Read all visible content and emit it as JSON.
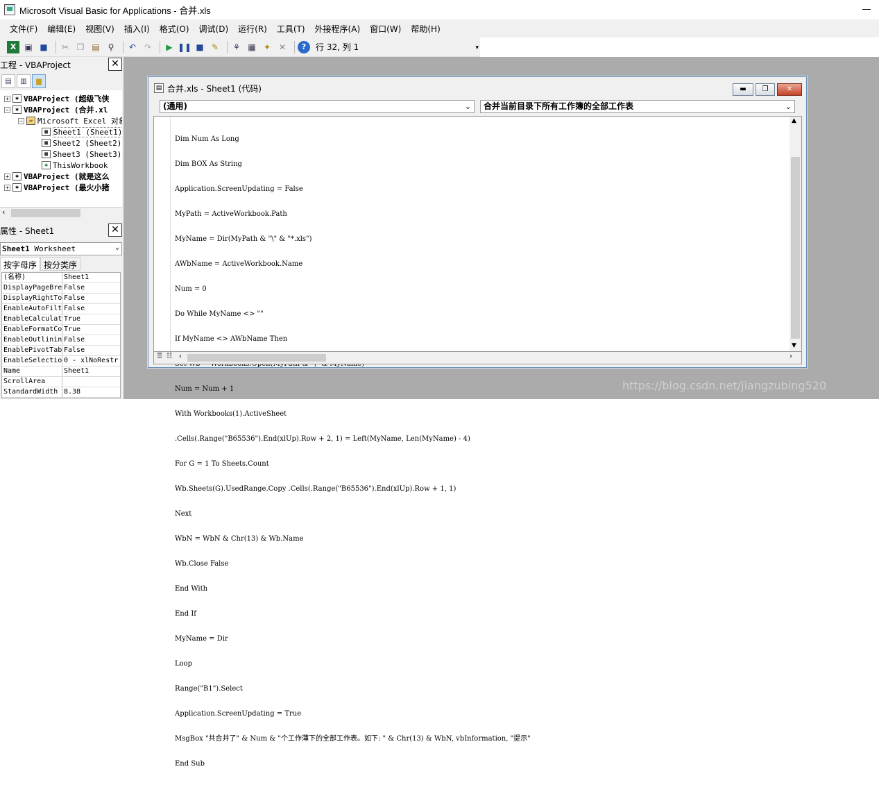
{
  "window": {
    "title": "Microsoft Visual Basic for Applications - 合并.xls"
  },
  "menu": [
    "文件(F)",
    "编辑(E)",
    "视图(V)",
    "插入(I)",
    "格式(O)",
    "调试(D)",
    "运行(R)",
    "工具(T)",
    "外接程序(A)",
    "窗口(W)",
    "帮助(H)"
  ],
  "toolbar": {
    "position": "行 32, 列 1"
  },
  "project_pane": {
    "title": "工程 - VBAProject",
    "nodes": [
      {
        "label": "VBAProject (超级飞侠",
        "bold": true
      },
      {
        "label": "VBAProject (合并.xl",
        "bold": true
      },
      {
        "label": "Microsoft Excel 对象",
        "bold": false
      },
      {
        "label": "Sheet1 (Sheet1)",
        "bold": false
      },
      {
        "label": "Sheet2 (Sheet2)",
        "bold": false
      },
      {
        "label": "Sheet3 (Sheet3)",
        "bold": false
      },
      {
        "label": "ThisWorkbook",
        "bold": false
      },
      {
        "label": "VBAProject (就是这么",
        "bold": true
      },
      {
        "label": "VBAProject (最火小猪",
        "bold": true
      }
    ]
  },
  "properties_pane": {
    "title": "属性 - Sheet1",
    "object_name": "Sheet1",
    "object_type": "Worksheet",
    "tabs": [
      "按字母序",
      "按分类序"
    ],
    "rows": [
      [
        "(名称)",
        "Sheet1"
      ],
      [
        "DisplayPageBre",
        "False"
      ],
      [
        "DisplayRightTo",
        "False"
      ],
      [
        "EnableAutoFilt",
        "False"
      ],
      [
        "EnableCalculat",
        "True"
      ],
      [
        "EnableFormatCo",
        "True"
      ],
      [
        "EnableOutlinin",
        "False"
      ],
      [
        "EnablePivotTab",
        "False"
      ],
      [
        "EnableSelectio",
        "0 - xlNoRestr"
      ],
      [
        "Name",
        "Sheet1"
      ],
      [
        "ScrollArea",
        ""
      ],
      [
        "StandardWidth",
        "8.38"
      ]
    ]
  },
  "code_window": {
    "title": "合并.xls - Sheet1 (代码)",
    "object_combo": "(通用)",
    "proc_combo": "合并当前目录下所有工作簿的全部工作表",
    "lines": [
      "Dim Num As Long",
      "Dim BOX As String",
      "Application.ScreenUpdating = False",
      "MyPath = ActiveWorkbook.Path",
      "MyName = Dir(MyPath & \"\\\" & \"*.xls\")",
      "AWbName = ActiveWorkbook.Name",
      "Num = 0",
      "Do While MyName <> \"\"",
      "If MyName <> AWbName Then",
      "Set Wb = Workbooks.Open(MyPath & \"\\\" & MyName)",
      "Num = Num + 1",
      "With Workbooks(1).ActiveSheet",
      ".Cells(.Range(\"B65536\").End(xlUp).Row + 2, 1) = Left(MyName, Len(MyName) - 4)",
      "For G = 1 To Sheets.Count",
      "Wb.Sheets(G).UsedRange.Copy .Cells(.Range(\"B65536\").End(xlUp).Row + 1, 1)",
      "Next",
      "WbN = WbN & Chr(13) & Wb.Name",
      "Wb.Close False",
      "End With",
      "End If",
      "MyName = Dir",
      "Loop",
      "Range(\"B1\").Select",
      "Application.ScreenUpdating = True",
      "MsgBox \"共合并了\" & Num & \"个工作薄下的全部工作表。如下: \" & Chr(13) & WbN, vbInformation, \"提示\"",
      "End Sub"
    ]
  },
  "watermark": "https://blog.csdn.net/jiangzubing520"
}
